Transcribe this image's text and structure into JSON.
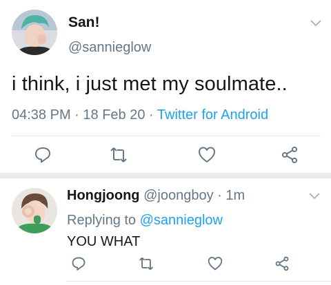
{
  "main_tweet": {
    "display_name": "San!",
    "handle": "@sannieglow",
    "text": "i think, i just met my soulmate..",
    "time": "04:38 PM",
    "separator": "·",
    "date": "18 Feb 20",
    "source": "Twitter for Android"
  },
  "reply_tweet": {
    "display_name": "Hongjoong",
    "handle": "@joongboy",
    "separator": "·",
    "age": "1m",
    "replying_prefix": "Replying to",
    "replying_handle": "@sannieglow",
    "text": "YOU WHAT"
  },
  "colors": {
    "link": "#1da1f2",
    "muted": "#657786",
    "text": "#14171a",
    "divider": "#e1e8ed"
  },
  "icons": [
    "chevron-down-icon",
    "reply-icon",
    "retweet-icon",
    "heart-icon",
    "share-icon"
  ]
}
